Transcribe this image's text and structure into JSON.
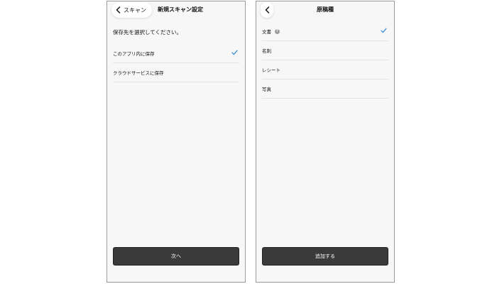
{
  "left_screen": {
    "back_label": "スキャン",
    "title": "新規スキャン設定",
    "prompt": "保存先を選択してください。",
    "options": [
      {
        "label": "このアプリ内に保存",
        "selected": true
      },
      {
        "label": "クラウドサービスに保存",
        "selected": false
      }
    ],
    "button_label": "次へ"
  },
  "right_screen": {
    "title": "原稿種",
    "options": [
      {
        "label": "文書",
        "selected": true,
        "help": "?"
      },
      {
        "label": "名刺",
        "selected": false
      },
      {
        "label": "レシート",
        "selected": false
      },
      {
        "label": "写真",
        "selected": false
      }
    ],
    "button_label": "追加する"
  },
  "colors": {
    "check_mark": "#3d8fd9",
    "button_background": "#3a3a3a",
    "screen_background": "#f7f7f7"
  },
  "icons": {
    "back": "chevron-left-icon",
    "check": "checkmark-icon",
    "help": "question-circle-icon"
  }
}
